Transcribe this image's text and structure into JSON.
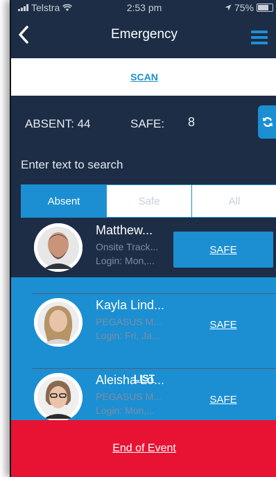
{
  "status_bar": {
    "carrier": "Telstra",
    "time": "2:53 pm",
    "battery": "75%"
  },
  "nav": {
    "title": "Emergency",
    "back_icon": "chevron-left-icon",
    "menu_icon": "hamburger-menu-icon"
  },
  "top_tabs": {
    "scan": "SCAN",
    "list": "LIST"
  },
  "counts": {
    "absent_label": "ABSENT: 44",
    "safe_label": "SAFE:",
    "safe_value": "8"
  },
  "search": {
    "placeholder": "Enter text to search"
  },
  "filter_tabs": {
    "absent": "Absent",
    "safe": "Safe",
    "all": "All",
    "selected": "Absent"
  },
  "people": [
    {
      "name": "Matthew...",
      "org": "Onsite Track...",
      "login": "Login: Mon,...",
      "action": "SAFE"
    },
    {
      "name": "Kayla Lind...",
      "org": "PEGASUS M...",
      "login": "Login: Fri, Ja...",
      "action": "SAFE"
    },
    {
      "name": "Aleisha Lo...",
      "org": "PEGASUS M...",
      "login": "Login: Mon,...",
      "action": "SAFE"
    }
  ],
  "footer": {
    "end_label": "End of Event"
  },
  "colors": {
    "background": "#1c2d45",
    "accent": "#1b8fd2",
    "danger": "#e81233"
  }
}
